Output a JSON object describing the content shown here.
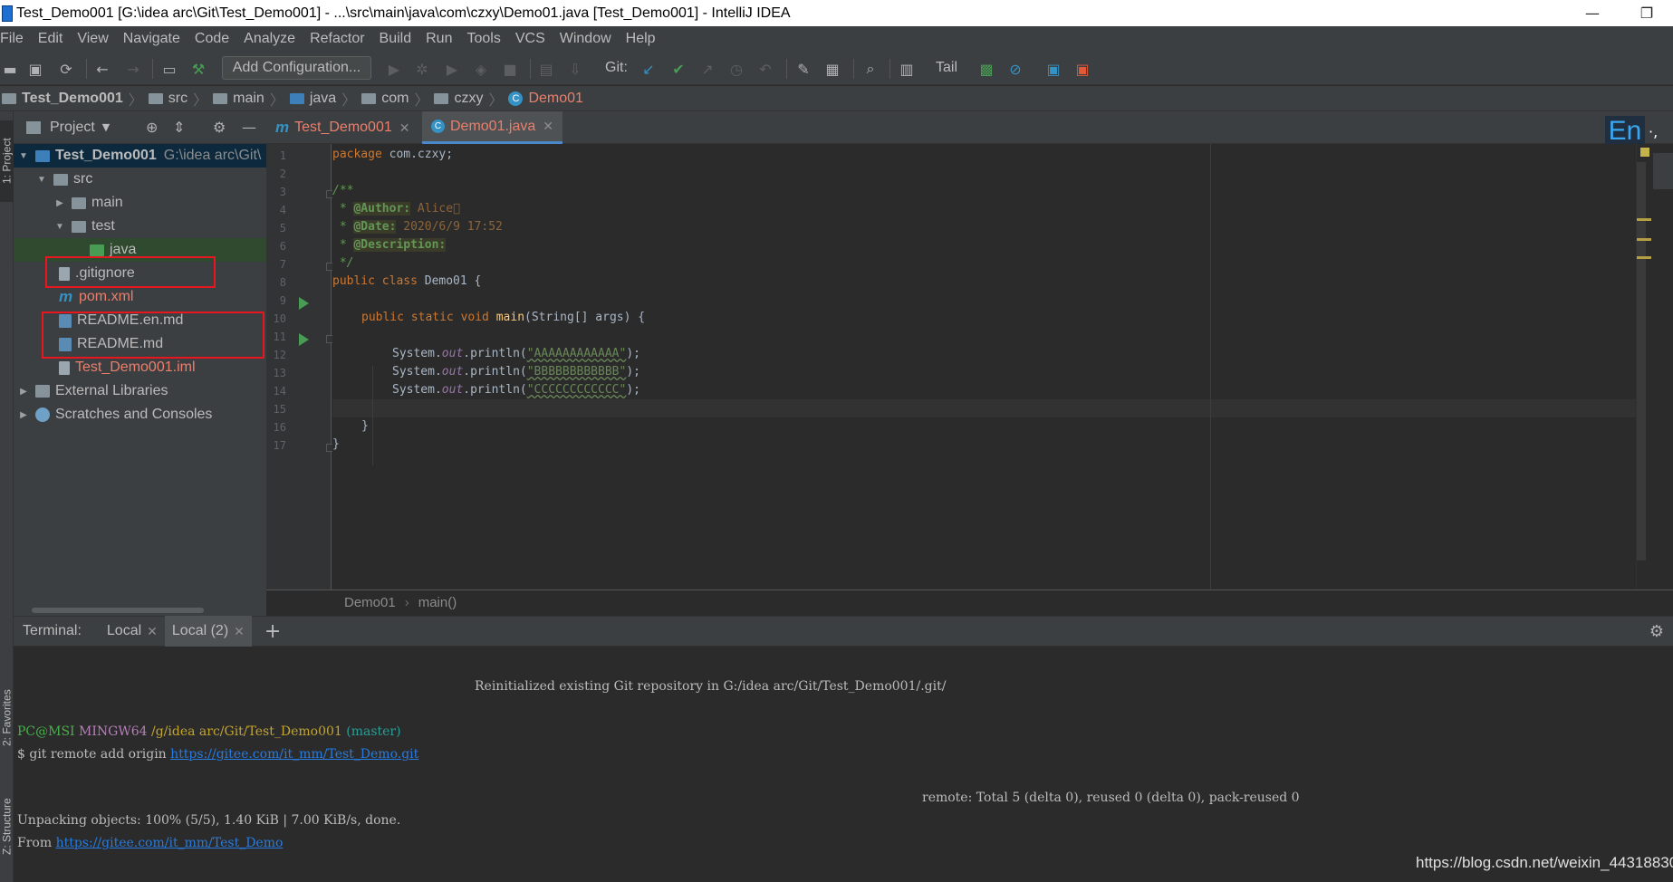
{
  "window": {
    "title": "Test_Demo001 [G:\\idea arc\\Git\\Test_Demo001] - ...\\src\\main\\java\\com\\czxy\\Demo01.java [Test_Demo001] - IntelliJ IDEA",
    "minimize": "—",
    "maximize": "❐"
  },
  "menu": [
    "File",
    "Edit",
    "View",
    "Navigate",
    "Code",
    "Analyze",
    "Refactor",
    "Build",
    "Run",
    "Tools",
    "VCS",
    "Window",
    "Help"
  ],
  "toolbar": {
    "add_configuration": "Add Configuration...",
    "git_label": "Git:",
    "tail_label": "Tail"
  },
  "breadcrumb": [
    "Test_Demo001",
    "src",
    "main",
    "java",
    "com",
    "czxy",
    "Demo01"
  ],
  "side_tabs": {
    "project": "1: Project",
    "favorites": "2: Favorites",
    "structure": "Z: Structure"
  },
  "project_panel": {
    "title": "Project",
    "root_name": "Test_Demo001",
    "root_path": "G:\\idea arc\\Git\\",
    "items": [
      {
        "label": "src"
      },
      {
        "label": "main"
      },
      {
        "label": "test"
      },
      {
        "label": "java"
      },
      {
        "label": ".gitignore"
      },
      {
        "label": "pom.xml"
      },
      {
        "label": "README.en.md"
      },
      {
        "label": "README.md"
      },
      {
        "label": "Test_Demo001.iml"
      },
      {
        "label": "External Libraries"
      },
      {
        "label": "Scratches and Consoles"
      }
    ]
  },
  "editor": {
    "tabs": [
      {
        "label": "Test_Demo001"
      },
      {
        "label": "Demo01.java"
      }
    ],
    "lang_badge": "En",
    "lang_extra": "·,",
    "line_numbers": [
      "1",
      "2",
      "3",
      "4",
      "5",
      "6",
      "7",
      "8",
      "9",
      "10",
      "11",
      "12",
      "13",
      "14",
      "15",
      "16",
      "17"
    ],
    "code": {
      "l1_kw": "package",
      "l1_pkg": " com.czxy;",
      "l3": "/**",
      "l4_star": " * ",
      "l4_tag": "@Author:",
      "l4_text": " Alice\u0000",
      "l5_star": " * ",
      "l5_tag": "@Date:",
      "l5_text": " 2020/6/9 17:52",
      "l6_star": " * ",
      "l6_tag": "@Description:",
      "l7": " */",
      "l8_kw": "public class",
      "l8_name": " Demo01 {",
      "l10_kw": "public static void",
      "l10_method": " main",
      "l10_rest": "(String[] args) {",
      "sys": "System.",
      "out": "out",
      "println": ".println(",
      "l12_str": "\"AAAAAAAAAAAA\"",
      "l13_str": "\"BBBBBBBBBBBB\"",
      "l14_str": "\"CCCCCCCCCCCC\"",
      "close_paren": ");",
      "l16": "}",
      "l17": "}"
    },
    "breadcrumb": [
      "Demo01",
      "main()"
    ]
  },
  "terminal": {
    "title": "Terminal:",
    "tabs": [
      {
        "label": "Local"
      },
      {
        "label": "Local (2)"
      }
    ],
    "lines": {
      "reinit": "Reinitialized existing Git repository in G:/idea arc/Git/Test_Demo001/.git/",
      "prompt_user": "PC@MSI",
      "prompt_host": " MINGW64",
      "prompt_path": " /g/idea arc/Git/Test_Demo001",
      "prompt_branch": " (master)",
      "cmd_prefix": "$ git remote add origin ",
      "cmd_url": "https://gitee.com/it_mm/Test_Demo.git",
      "remote_total": "remote: Total 5 (delta 0), reused 0 (delta 0), pack-reused 0",
      "unpacking": "Unpacking objects: 100% (5/5), 1.40 KiB | 7.00 KiB/s, done.",
      "from_prefix": "From ",
      "from_url": "https://gitee.com/it_mm/Test_Demo"
    }
  },
  "watermark": "https://blog.csdn.net/weixin_44318830",
  "colors": {
    "background": "#2b2b2b",
    "panel": "#3c3f41",
    "selection": "#0d293e",
    "accent_blue": "#3592c4",
    "file_red": "#ea7f6c",
    "annotation_box": "#e8161e"
  }
}
